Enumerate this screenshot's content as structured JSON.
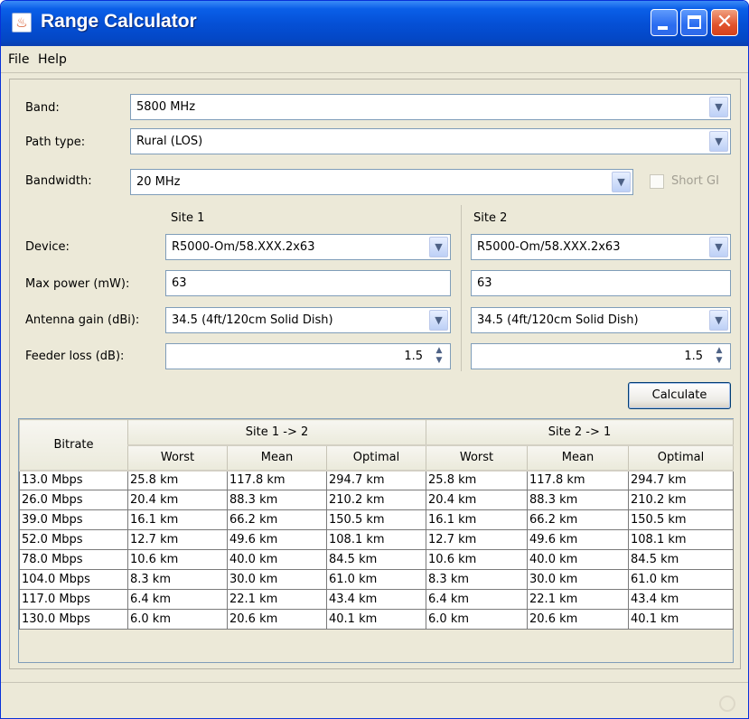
{
  "window": {
    "title": "Range Calculator"
  },
  "menu": {
    "file": "File",
    "help": "Help"
  },
  "form": {
    "band_label": "Band:",
    "band_value": "5800 MHz",
    "path_type_label": "Path type:",
    "path_type_value": "Rural (LOS)",
    "bandwidth_label": "Bandwidth:",
    "bandwidth_value": "20 MHz",
    "short_gi_label": "Short GI",
    "site1_header": "Site 1",
    "site2_header": "Site 2",
    "device_label": "Device:",
    "max_power_label": "Max power (mW):",
    "antenna_gain_label": "Antenna gain (dBi):",
    "feeder_loss_label": "Feeder loss (dB):",
    "site1": {
      "device": "R5000-Om/58.XXX.2x63",
      "max_power": "63",
      "antenna_gain": "34.5 (4ft/120cm Solid Dish)",
      "feeder_loss": "1.5"
    },
    "site2": {
      "device": "R5000-Om/58.XXX.2x63",
      "max_power": "63",
      "antenna_gain": "34.5 (4ft/120cm Solid Dish)",
      "feeder_loss": "1.5"
    },
    "calculate_label": "Calculate"
  },
  "table": {
    "bitrate_header": "Bitrate",
    "group1_header": "Site 1 -> 2",
    "group2_header": "Site 2 -> 1",
    "worst": "Worst",
    "mean": "Mean",
    "optimal": "Optimal",
    "rows": [
      [
        "13.0 Mbps",
        "25.8 km",
        "117.8 km",
        "294.7 km",
        "25.8 km",
        "117.8 km",
        "294.7 km"
      ],
      [
        "26.0 Mbps",
        "20.4 km",
        "88.3 km",
        "210.2 km",
        "20.4 km",
        "88.3 km",
        "210.2 km"
      ],
      [
        "39.0 Mbps",
        "16.1 km",
        "66.2 km",
        "150.5 km",
        "16.1 km",
        "66.2 km",
        "150.5 km"
      ],
      [
        "52.0 Mbps",
        "12.7 km",
        "49.6 km",
        "108.1 km",
        "12.7 km",
        "49.6 km",
        "108.1 km"
      ],
      [
        "78.0 Mbps",
        "10.6 km",
        "40.0 km",
        "84.5 km",
        "10.6 km",
        "40.0 km",
        "84.5 km"
      ],
      [
        "104.0 Mbps",
        "8.3 km",
        "30.0 km",
        "61.0 km",
        "8.3 km",
        "30.0 km",
        "61.0 km"
      ],
      [
        "117.0 Mbps",
        "6.4 km",
        "22.1 km",
        "43.4 km",
        "6.4 km",
        "22.1 km",
        "43.4 km"
      ],
      [
        "130.0 Mbps",
        "6.0 km",
        "20.6 km",
        "40.1 km",
        "6.0 km",
        "20.6 km",
        "40.1 km"
      ]
    ]
  },
  "icons": {
    "app": "java-cup-icon",
    "minimize": "minimize-icon",
    "maximize": "maximize-icon",
    "close": "close-icon",
    "dropdown": "chevron-down-icon",
    "spinner": "spinner-arrows-icon"
  },
  "colors": {
    "titlebar": "#0550d6",
    "window_bg": "#ece9d8",
    "field_border": "#7f9db9",
    "close_button": "#e0522c"
  }
}
